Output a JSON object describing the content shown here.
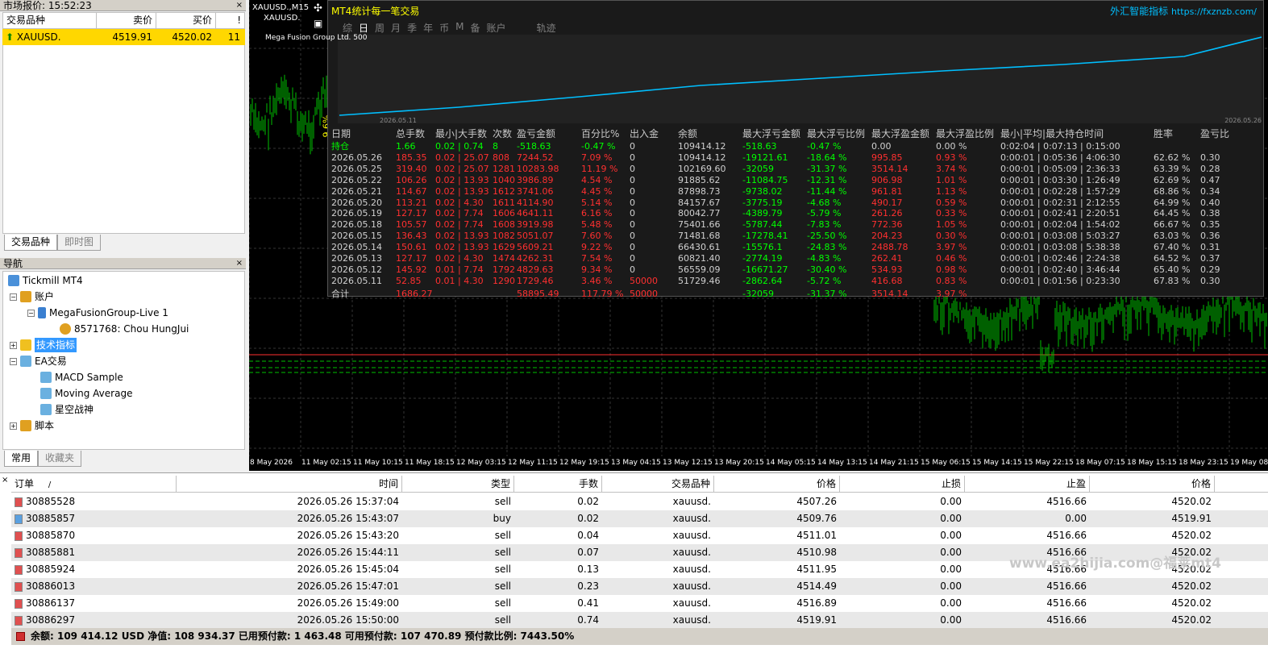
{
  "market_watch": {
    "title": "市场报价: 15:52:23",
    "close": "×",
    "headers": [
      "交易品种",
      "卖价",
      "买价",
      "!"
    ],
    "row": {
      "symbol": "XAUUSD.",
      "bid": "4519.91",
      "ask": "4520.02",
      "spread": "11"
    },
    "tabs": [
      "交易品种",
      "即时图"
    ]
  },
  "navigator": {
    "title": "导航",
    "close": "×",
    "items": [
      "Tickmill MT4",
      "账户",
      "MegaFusionGroup-Live 1",
      "8571768: Chou HungJui",
      "技术指标",
      "EA交易",
      "MACD Sample",
      "Moving Average",
      "星空战神",
      "脚本"
    ],
    "tabs": [
      "常用",
      "收藏夹"
    ]
  },
  "chart": {
    "symbol_tf": "XAUUSD.,M15",
    "symbol": "XAUUSD.",
    "indicator_title": "MT4统计每一笔交易",
    "brand": "外汇智能指标",
    "brand_url": "https://fxznzb.com/",
    "menu": [
      "综",
      "日",
      "周",
      "月",
      "季",
      "年",
      "币",
      "M",
      "备",
      "账户",
      "轨迹"
    ],
    "equity_label": "Mega Fusion Group Ltd.",
    "equity_num": "500",
    "curve_start": "2026.05.11",
    "curve_end": "2026.05.26",
    "y_label": "9.6%",
    "x_ticks": [
      "8 May 2026",
      "11 May 02:15",
      "11 May 10:15",
      "11 May 18:15",
      "12 May 03:15",
      "12 May 11:15",
      "12 May 19:15",
      "13 May 04:15",
      "13 May 12:15",
      "13 May 20:15",
      "14 May 05:15",
      "14 May 13:15",
      "14 May 21:15",
      "15 May 06:15",
      "15 May 14:15",
      "15 May 22:15",
      "18 May 07:15",
      "18 May 15:15",
      "18 May 23:15",
      "19 May 08"
    ],
    "stats_headers": [
      "日期",
      "总手数",
      "最小|大手数",
      "次数",
      "盈亏金额",
      "百分比%",
      "出入金",
      "余额",
      "最大浮亏金额",
      "最大浮亏比例",
      "最大浮盈金额",
      "最大浮盈比例",
      "最小|平均|最大持仓时间",
      "胜率",
      "盈亏比"
    ],
    "stats_rows": [
      [
        "持仓",
        "1.66",
        "0.02 | 0.74",
        "8",
        "-518.63",
        "-0.47 %",
        "0",
        "109414.12",
        "-518.63",
        "-0.47 %",
        "0.00",
        "0.00 %",
        "0:02:04 | 0:07:13 | 0:15:00",
        "",
        ""
      ],
      [
        "2026.05.26",
        "185.35",
        "0.02 | 25.07",
        "808",
        "7244.52",
        "7.09 %",
        "0",
        "109414.12",
        "-19121.61",
        "-18.64 %",
        "995.85",
        "0.93 %",
        "0:00:01 | 0:05:36 | 4:06:30",
        "62.62 %",
        "0.30"
      ],
      [
        "2026.05.25",
        "319.40",
        "0.02 | 25.07",
        "1281",
        "10283.98",
        "11.19 %",
        "0",
        "102169.60",
        "-32059",
        "-31.37 %",
        "3514.14",
        "3.74 %",
        "0:00:01 | 0:05:09 | 2:36:33",
        "63.39 %",
        "0.28"
      ],
      [
        "2026.05.22",
        "106.26",
        "0.02 | 13.93",
        "1040",
        "3986.89",
        "4.54 %",
        "0",
        "91885.62",
        "-11084.75",
        "-12.31 %",
        "906.98",
        "1.01 %",
        "0:00:01 | 0:03:30 | 1:26:49",
        "62.69 %",
        "0.47"
      ],
      [
        "2026.05.21",
        "114.67",
        "0.02 | 13.93",
        "1612",
        "3741.06",
        "4.45 %",
        "0",
        "87898.73",
        "-9738.02",
        "-11.44 %",
        "961.81",
        "1.13 %",
        "0:00:01 | 0:02:28 | 1:57:29",
        "68.86 %",
        "0.34"
      ],
      [
        "2026.05.20",
        "113.21",
        "0.02 | 4.30",
        "1611",
        "4114.90",
        "5.14 %",
        "0",
        "84157.67",
        "-3775.19",
        "-4.68 %",
        "490.17",
        "0.59 %",
        "0:00:01 | 0:02:31 | 2:12:55",
        "64.99 %",
        "0.40"
      ],
      [
        "2026.05.19",
        "127.17",
        "0.02 | 7.74",
        "1606",
        "4641.11",
        "6.16 %",
        "0",
        "80042.77",
        "-4389.79",
        "-5.79 %",
        "261.26",
        "0.33 %",
        "0:00:01 | 0:02:41 | 2:20:51",
        "64.45 %",
        "0.38"
      ],
      [
        "2026.05.18",
        "105.57",
        "0.02 | 7.74",
        "1608",
        "3919.98",
        "5.48 %",
        "0",
        "75401.66",
        "-5787.44",
        "-7.83 %",
        "772.36",
        "1.05 %",
        "0:00:01 | 0:02:04 | 1:54:02",
        "66.67 %",
        "0.35"
      ],
      [
        "2026.05.15",
        "136.43",
        "0.02 | 13.93",
        "1082",
        "5051.07",
        "7.60 %",
        "0",
        "71481.68",
        "-17278.41",
        "-25.50 %",
        "204.23",
        "0.30 %",
        "0:00:01 | 0:03:08 | 5:03:27",
        "63.03 %",
        "0.36"
      ],
      [
        "2026.05.14",
        "150.61",
        "0.02 | 13.93",
        "1629",
        "5609.21",
        "9.22 %",
        "0",
        "66430.61",
        "-15576.1",
        "-24.83 %",
        "2488.78",
        "3.97 %",
        "0:00:01 | 0:03:08 | 5:38:38",
        "67.40 %",
        "0.31"
      ],
      [
        "2026.05.13",
        "127.17",
        "0.02 | 4.30",
        "1474",
        "4262.31",
        "7.54 %",
        "0",
        "60821.40",
        "-2774.19",
        "-4.83 %",
        "262.41",
        "0.46 %",
        "0:00:01 | 0:02:46 | 2:24:38",
        "64.52 %",
        "0.37"
      ],
      [
        "2026.05.12",
        "145.92",
        "0.01 | 7.74",
        "1792",
        "4829.63",
        "9.34 %",
        "0",
        "56559.09",
        "-16671.27",
        "-30.40 %",
        "534.93",
        "0.98 %",
        "0:00:01 | 0:02:40 | 3:46:44",
        "65.40 %",
        "0.29"
      ],
      [
        "2026.05.11",
        "52.85",
        "0.01 | 4.30",
        "1290",
        "1729.46",
        "3.46 %",
        "50000",
        "51729.46",
        "-2862.64",
        "-5.72 %",
        "416.68",
        "0.83 %",
        "0:00:01 | 0:01:56 | 0:23:30",
        "67.83 %",
        "0.30"
      ],
      [
        "合计",
        "1686.27",
        "",
        "",
        "58895.49",
        "117.79 %",
        "50000",
        "",
        "-32059",
        "-31.37 %",
        "3514.14",
        "3.97 %",
        "",
        "",
        ""
      ]
    ],
    "colors": {
      "header": "#c8c8c8",
      "green": "#00ff00",
      "red": "#ff3030",
      "white": "#d0d0d0",
      "title": "#ffff00",
      "brand": "#00bfff",
      "curve": "#00bfff"
    }
  },
  "terminal": {
    "close": "×",
    "headers": [
      "订单",
      "/",
      "时间",
      "类型",
      "手数",
      "交易品种",
      "价格",
      "止损",
      "止盈",
      "价格"
    ],
    "rows": [
      [
        "30885528",
        "2026.05.26 15:37:04",
        "sell",
        "0.02",
        "xauusd.",
        "4507.26",
        "0.00",
        "4516.66",
        "4520.02"
      ],
      [
        "30885857",
        "2026.05.26 15:43:07",
        "buy",
        "0.02",
        "xauusd.",
        "4509.76",
        "0.00",
        "0.00",
        "4519.91"
      ],
      [
        "30885870",
        "2026.05.26 15:43:20",
        "sell",
        "0.04",
        "xauusd.",
        "4511.01",
        "0.00",
        "4516.66",
        "4520.02"
      ],
      [
        "30885881",
        "2026.05.26 15:44:11",
        "sell",
        "0.07",
        "xauusd.",
        "4510.98",
        "0.00",
        "4516.66",
        "4520.02"
      ],
      [
        "30885924",
        "2026.05.26 15:45:04",
        "sell",
        "0.13",
        "xauusd.",
        "4511.95",
        "0.00",
        "4516.66",
        "4520.02"
      ],
      [
        "30886013",
        "2026.05.26 15:47:01",
        "sell",
        "0.23",
        "xauusd.",
        "4514.49",
        "0.00",
        "4516.66",
        "4520.02"
      ],
      [
        "30886137",
        "2026.05.26 15:49:00",
        "sell",
        "0.41",
        "xauusd.",
        "4516.89",
        "0.00",
        "4516.66",
        "4520.02"
      ],
      [
        "30886297",
        "2026.05.26 15:50:00",
        "sell",
        "0.74",
        "xauusd.",
        "4519.91",
        "0.00",
        "4516.66",
        "4520.02"
      ]
    ],
    "status": "余额: 109 414.12 USD  净值: 108 934.37  已用预付款: 1 463.48  可用预付款: 107 470.89  预付款比例: 7443.50%",
    "watermark": "www.ea2hijia.com@福莱mt4"
  }
}
